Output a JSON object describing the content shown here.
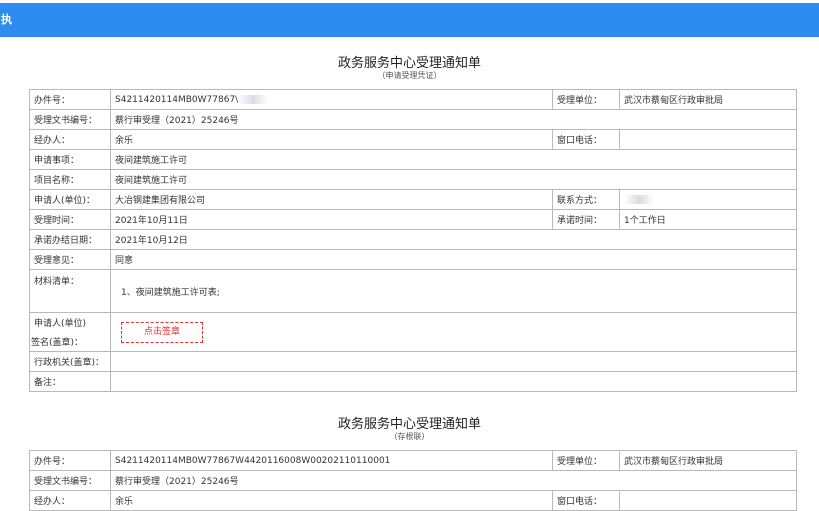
{
  "header": {
    "title": "执"
  },
  "form1": {
    "title": "政务服务中心受理通知单",
    "subtitle": "（申请受理凭证）",
    "labels": {
      "case_no": "办件号：",
      "doc_no": "受理文书编号：",
      "handler": "经办人：",
      "matter": "申请事项：",
      "project": "项目名称：",
      "applicant": "申请人(单位)：",
      "accept_time": "受理时间：",
      "due_date": "承诺办结日期：",
      "opinion": "受理意见：",
      "materials": "材料清单：",
      "sign_line1": "申请人(单位)",
      "sign_line2": "签名(盖章)：",
      "agency_seal": "行政机关(盖章)：",
      "remark": "备注：",
      "accept_unit": "受理单位：",
      "window_phone": "窗口电话：",
      "contact": "联系方式：",
      "promise_time": "承诺时间："
    },
    "values": {
      "case_no": "S4211420114MB0W77867\\",
      "doc_no": "蔡行审受理（2021）25246号",
      "handler": "余乐",
      "matter": "夜间建筑施工许可",
      "project": "夜间建筑施工许可",
      "applicant": "大冶钢建集团有限公司",
      "accept_time": "2021年10月11日",
      "due_date": "2021年10月12日",
      "opinion": "同意",
      "materials": "1、夜间建筑施工许可表;",
      "accept_unit": "武汉市蔡甸区行政审批局",
      "window_phone": "",
      "contact": "",
      "promise_time": "1个工作日",
      "agency_seal": "",
      "remark": ""
    },
    "sign_button": "点击签章"
  },
  "form2": {
    "title": "政务服务中心受理通知单",
    "subtitle": "（存根联）",
    "labels": {
      "case_no": "办件号：",
      "doc_no": "受理文书编号：",
      "handler": "经办人：",
      "accept_unit": "受理单位：",
      "window_phone": "窗口电话："
    },
    "values": {
      "case_no": "S4211420114MB0W77867W4420116008W00202110110001",
      "doc_no": "蔡行审受理（2021）25246号",
      "handler": "余乐",
      "accept_unit": "武汉市蔡甸区行政审批局",
      "window_phone": ""
    }
  }
}
